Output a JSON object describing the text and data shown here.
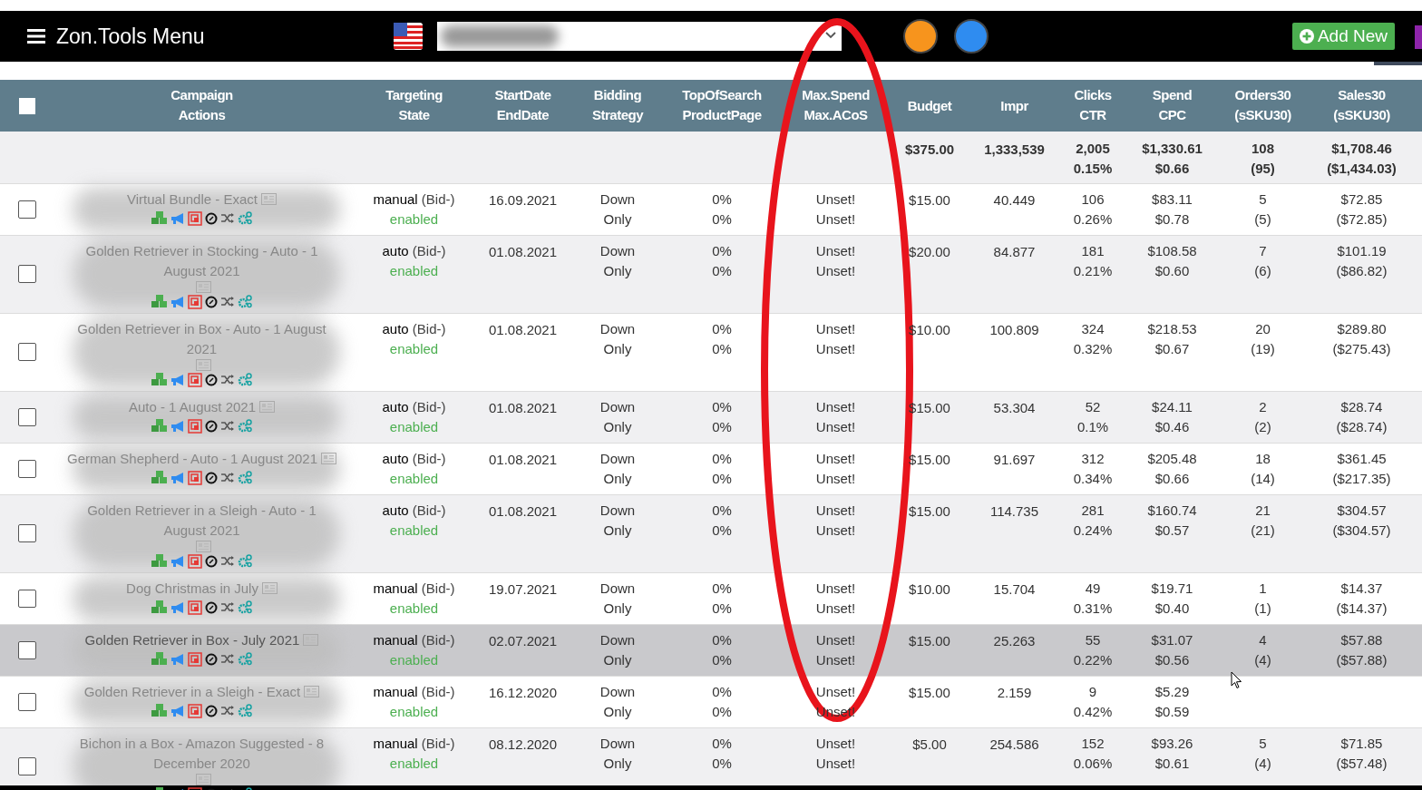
{
  "topbar": {
    "menu_label": "Zon.Tools Menu",
    "badges": [
      {
        "color": "#f7941d"
      },
      {
        "color": "#2f8cf0"
      }
    ],
    "add_button": "Add New"
  },
  "table": {
    "select_all": {
      "checked": false
    },
    "columns": [
      [
        "Campaign",
        "Actions"
      ],
      [
        "Targeting",
        "State"
      ],
      [
        "StartDate",
        "EndDate"
      ],
      [
        "Bidding",
        "Strategy"
      ],
      [
        "TopOfSearch",
        "ProductPage"
      ],
      [
        "Max.Spend",
        "Max.ACoS"
      ],
      [
        "Budget"
      ],
      [
        "Impr"
      ],
      [
        "Clicks",
        "CTR"
      ],
      [
        "Spend",
        "CPC"
      ],
      [
        "Orders30",
        "(sSKU30)"
      ],
      [
        "Sales30",
        "(sSKU30)"
      ]
    ],
    "totals": {
      "budget": "$375.00",
      "impr": "1,333,539",
      "clicks": [
        "2,005",
        "0.15%"
      ],
      "spend": [
        "$1,330.61",
        "$0.66"
      ],
      "orders": [
        "108",
        "(95)"
      ],
      "sales": [
        "$1,708.46",
        "($1,434.03)"
      ]
    },
    "rows": [
      {
        "checked": false,
        "highlighted": false,
        "name": "Virtual Bundle - Exact",
        "targeting": "manual",
        "bid": "(Bid-)",
        "state": "enabled",
        "date": "16.09.2021",
        "bidding": [
          "Down",
          "Only"
        ],
        "tos": [
          "0%",
          "0%"
        ],
        "max": [
          "Unset!",
          "Unset!"
        ],
        "budget": "$15.00",
        "impr": "40.449",
        "clicks": [
          "106",
          "0.26%"
        ],
        "spend": [
          "$83.11",
          "$0.78"
        ],
        "orders": [
          "5",
          "(5)"
        ],
        "sales": [
          "$72.85",
          "($72.85)"
        ]
      },
      {
        "checked": false,
        "highlighted": false,
        "name": "Golden Retriever in Stocking - Auto - 1 August 2021",
        "targeting": "auto",
        "bid": "(Bid-)",
        "state": "enabled",
        "date": "01.08.2021",
        "bidding": [
          "Down",
          "Only"
        ],
        "tos": [
          "0%",
          "0%"
        ],
        "max": [
          "Unset!",
          "Unset!"
        ],
        "budget": "$20.00",
        "impr": "84.877",
        "clicks": [
          "181",
          "0.21%"
        ],
        "spend": [
          "$108.58",
          "$0.60"
        ],
        "orders": [
          "7",
          "(6)"
        ],
        "sales": [
          "$101.19",
          "($86.82)"
        ]
      },
      {
        "checked": false,
        "highlighted": false,
        "name": "Golden Retriever in Box - Auto - 1 August 2021",
        "targeting": "auto",
        "bid": "(Bid-)",
        "state": "enabled",
        "date": "01.08.2021",
        "bidding": [
          "Down",
          "Only"
        ],
        "tos": [
          "0%",
          "0%"
        ],
        "max": [
          "Unset!",
          "Unset!"
        ],
        "budget": "$10.00",
        "impr": "100.809",
        "clicks": [
          "324",
          "0.32%"
        ],
        "spend": [
          "$218.53",
          "$0.67"
        ],
        "orders": [
          "20",
          "(19)"
        ],
        "sales": [
          "$289.80",
          "($275.43)"
        ]
      },
      {
        "checked": false,
        "highlighted": false,
        "name": "Auto - 1 August 2021",
        "targeting": "auto",
        "bid": "(Bid-)",
        "state": "enabled",
        "date": "01.08.2021",
        "bidding": [
          "Down",
          "Only"
        ],
        "tos": [
          "0%",
          "0%"
        ],
        "max": [
          "Unset!",
          "Unset!"
        ],
        "budget": "$15.00",
        "impr": "53.304",
        "clicks": [
          "52",
          "0.1%"
        ],
        "spend": [
          "$24.11",
          "$0.46"
        ],
        "orders": [
          "2",
          "(2)"
        ],
        "sales": [
          "$28.74",
          "($28.74)"
        ]
      },
      {
        "checked": false,
        "highlighted": false,
        "name": "German Shepherd - Auto - 1 August 2021",
        "targeting": "auto",
        "bid": "(Bid-)",
        "state": "enabled",
        "date": "01.08.2021",
        "bidding": [
          "Down",
          "Only"
        ],
        "tos": [
          "0%",
          "0%"
        ],
        "max": [
          "Unset!",
          "Unset!"
        ],
        "budget": "$15.00",
        "impr": "91.697",
        "clicks": [
          "312",
          "0.34%"
        ],
        "spend": [
          "$205.48",
          "$0.66"
        ],
        "orders": [
          "18",
          "(14)"
        ],
        "sales": [
          "$361.45",
          "($217.35)"
        ]
      },
      {
        "checked": false,
        "highlighted": false,
        "name": "Golden Retriever in a Sleigh - Auto - 1 August 2021",
        "targeting": "auto",
        "bid": "(Bid-)",
        "state": "enabled",
        "date": "01.08.2021",
        "bidding": [
          "Down",
          "Only"
        ],
        "tos": [
          "0%",
          "0%"
        ],
        "max": [
          "Unset!",
          "Unset!"
        ],
        "budget": "$15.00",
        "impr": "114.735",
        "clicks": [
          "281",
          "0.24%"
        ],
        "spend": [
          "$160.74",
          "$0.57"
        ],
        "orders": [
          "21",
          "(21)"
        ],
        "sales": [
          "$304.57",
          "($304.57)"
        ]
      },
      {
        "checked": false,
        "highlighted": false,
        "name": "Dog Christmas in July",
        "targeting": "manual",
        "bid": "(Bid-)",
        "state": "enabled",
        "date": "19.07.2021",
        "bidding": [
          "Down",
          "Only"
        ],
        "tos": [
          "0%",
          "0%"
        ],
        "max": [
          "Unset!",
          "Unset!"
        ],
        "budget": "$10.00",
        "impr": "15.704",
        "clicks": [
          "49",
          "0.31%"
        ],
        "spend": [
          "$19.71",
          "$0.40"
        ],
        "orders": [
          "1",
          "(1)"
        ],
        "sales": [
          "$14.37",
          "($14.37)"
        ]
      },
      {
        "checked": false,
        "highlighted": true,
        "name": "Golden Retriever in Box - July 2021",
        "targeting": "manual",
        "bid": "(Bid-)",
        "state": "enabled",
        "date": "02.07.2021",
        "bidding": [
          "Down",
          "Only"
        ],
        "tos": [
          "0%",
          "0%"
        ],
        "max": [
          "Unset!",
          "Unset!"
        ],
        "budget": "$15.00",
        "impr": "25.263",
        "clicks": [
          "55",
          "0.22%"
        ],
        "spend": [
          "$31.07",
          "$0.56"
        ],
        "orders": [
          "4",
          "(4)"
        ],
        "sales": [
          "$57.88",
          "($57.88)"
        ]
      },
      {
        "checked": false,
        "highlighted": false,
        "name": "Golden Retriever in a Sleigh - Exact",
        "targeting": "manual",
        "bid": "(Bid-)",
        "state": "enabled",
        "date": "16.12.2020",
        "bidding": [
          "Down",
          "Only"
        ],
        "tos": [
          "0%",
          "0%"
        ],
        "max": [
          "Unset!",
          "Unset!"
        ],
        "budget": "$15.00",
        "impr": "2.159",
        "clicks": [
          "9",
          "0.42%"
        ],
        "spend": [
          "$5.29",
          "$0.59"
        ]
      },
      {
        "checked": false,
        "highlighted": false,
        "name": "Bichon in a Box - Amazon Suggested - 8 December 2020",
        "targeting": "manual",
        "bid": "(Bid-)",
        "state": "enabled",
        "date": "08.12.2020",
        "bidding": [
          "Down",
          "Only"
        ],
        "tos": [
          "0%",
          "0%"
        ],
        "max": [
          "Unset!",
          "Unset!"
        ],
        "budget": "$5.00",
        "impr": "254.586",
        "clicks": [
          "152",
          "0.06%"
        ],
        "spend": [
          "$93.26",
          "$0.61"
        ],
        "orders": [
          "5",
          "(4)"
        ],
        "sales": [
          "$71.85",
          "($57.48)"
        ]
      }
    ]
  }
}
